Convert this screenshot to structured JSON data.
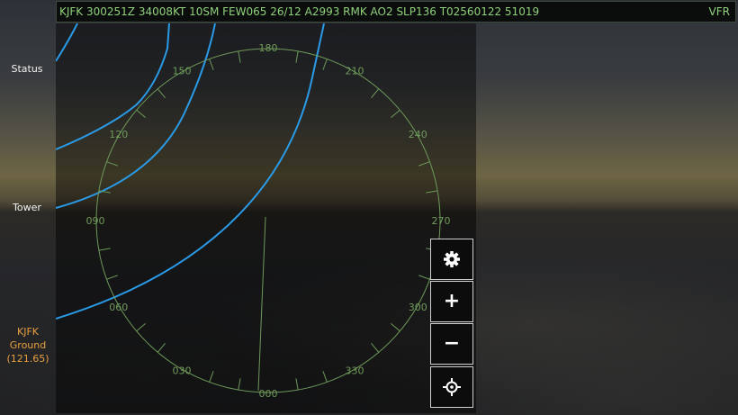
{
  "metar": {
    "text": "KJFK 300251Z 34008KT 10SM FEW065 26/12 A2993 RMK AO2 SLP136 T02560122 51019",
    "flight_rules": "VFR"
  },
  "sidebar": {
    "status_label": "Status",
    "tower_label": "Tower",
    "frequency": {
      "airport": "KJFK",
      "facility": "Ground",
      "freq": "(121.65)"
    }
  },
  "compass": {
    "labels": [
      "000",
      "030",
      "060",
      "090",
      "120",
      "150",
      "180",
      "210",
      "240",
      "270",
      "300",
      "330"
    ]
  },
  "controls": {
    "settings_icon": "gear-icon",
    "zoom_in_symbol": "+",
    "zoom_out_symbol": "−",
    "recenter_icon": "crosshair-icon"
  },
  "colors": {
    "metar_text": "#8fd07c",
    "compass": "#6f9a5a",
    "approach_lines": "#2a9ae6",
    "frequency": "#e8a040"
  }
}
